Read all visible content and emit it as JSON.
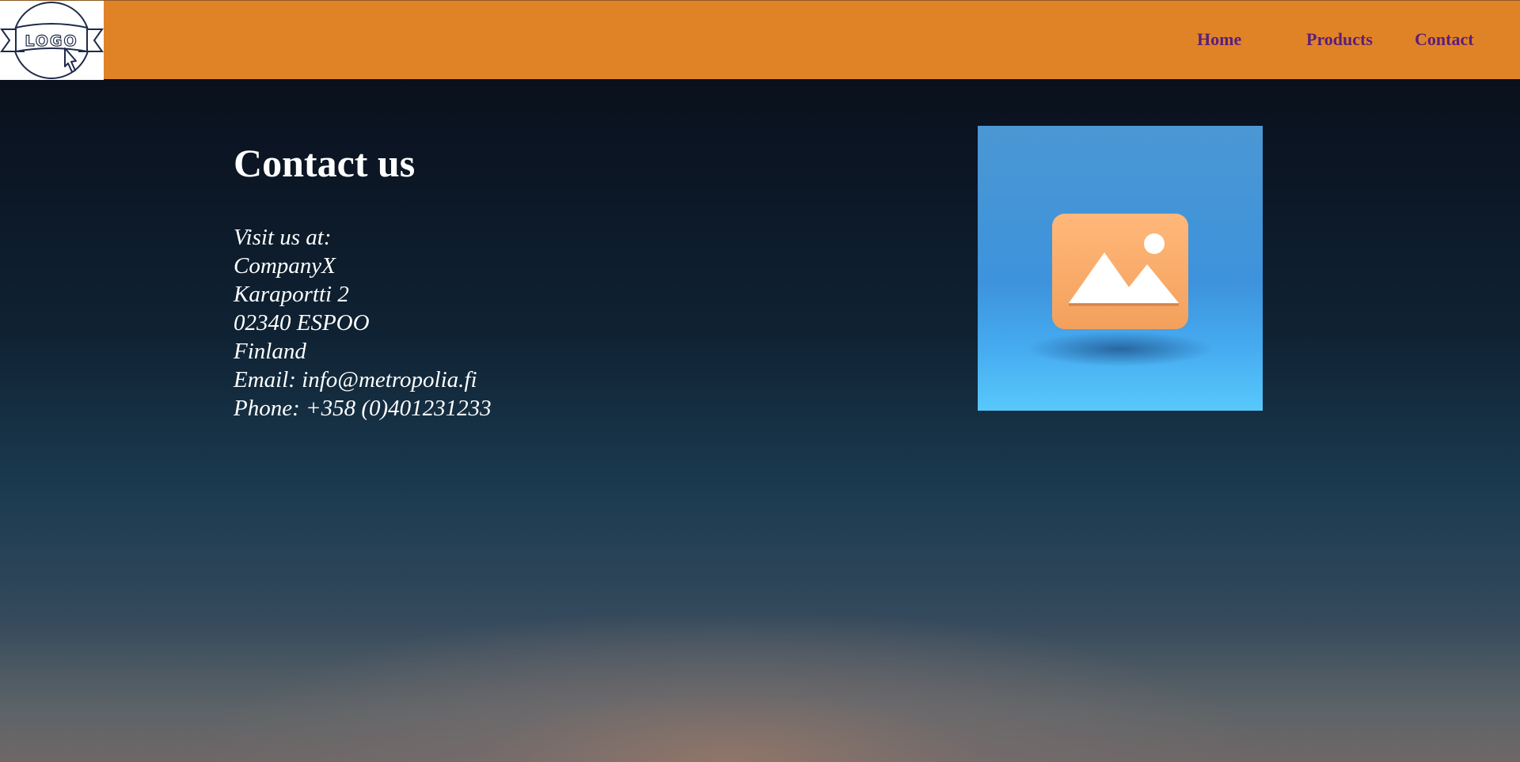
{
  "header": {
    "logo_text": "LOGO",
    "nav": {
      "home": "Home",
      "products": "Products",
      "contact": "Contact"
    }
  },
  "main": {
    "title": "Contact us",
    "address_lines": [
      "Visit us at:",
      "CompanyX",
      "Karaportti 2",
      "02340 ESPOO",
      "Finland",
      "Email: info@metropolia.fi",
      "Phone: +358 (0)401231233"
    ],
    "image_icon": "image-placeholder-icon"
  },
  "colors": {
    "header_bg": "#e08327",
    "nav_link": "#5a1e7a",
    "text": "#ffffff",
    "image_bg": "#4a9be0",
    "image_tile": "#f5a060"
  }
}
